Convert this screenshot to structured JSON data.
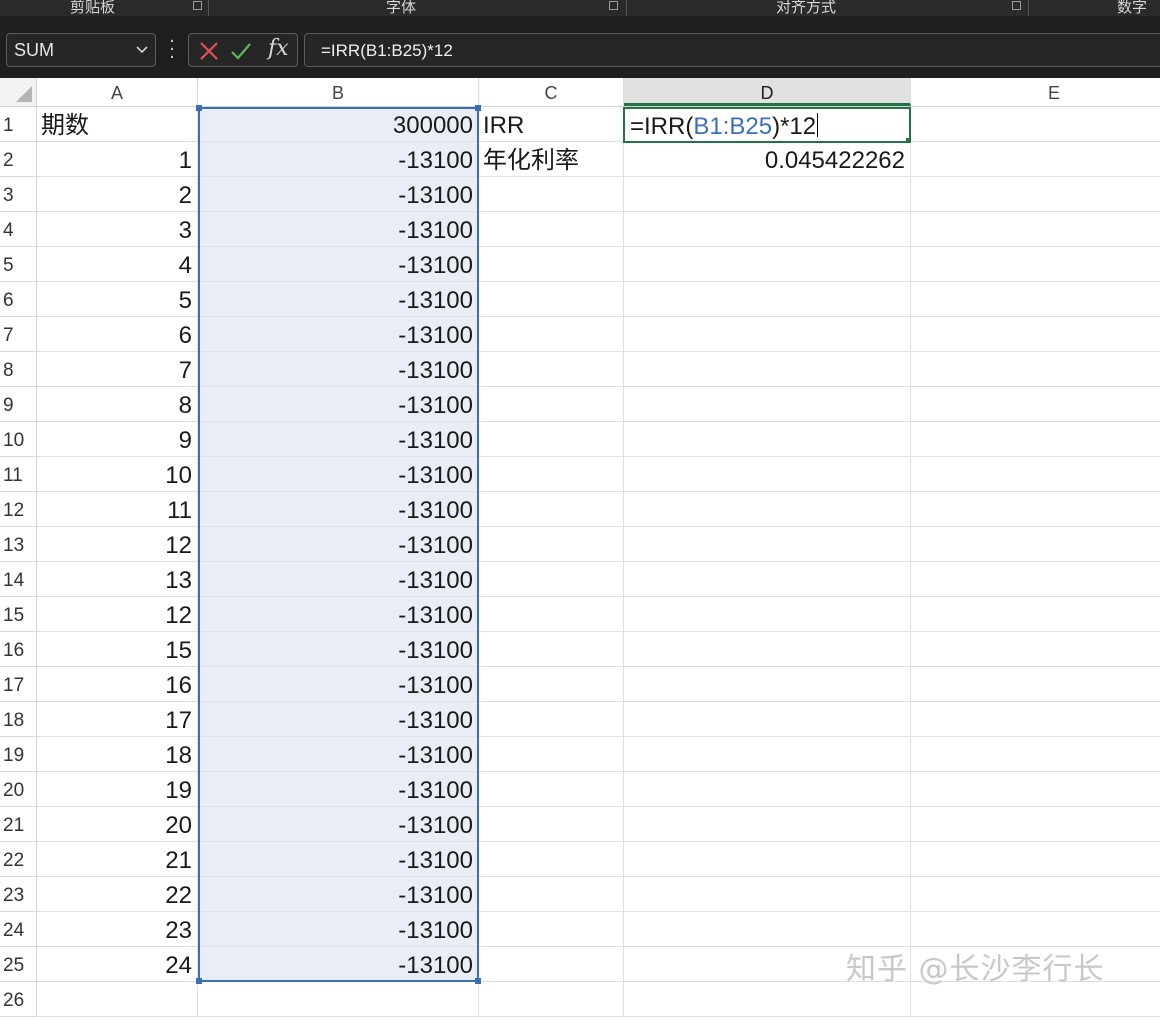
{
  "ribbon": {
    "groups": [
      "剪贴板",
      "字体",
      "对齐方式",
      "数字"
    ]
  },
  "formula_bar": {
    "name_box": "SUM",
    "fx_label": "fx",
    "formula": "=IRR(B1:B25)*12"
  },
  "columns": [
    "A",
    "B",
    "C",
    "D",
    "E"
  ],
  "active_column": "D",
  "rows": [
    {
      "n": "1",
      "a": "期数",
      "b": "300000",
      "c": "IRR"
    },
    {
      "n": "2",
      "a": "1",
      "b": "-13100",
      "c": "年化利率",
      "d": "0.045422262"
    },
    {
      "n": "3",
      "a": "2",
      "b": "-13100"
    },
    {
      "n": "4",
      "a": "3",
      "b": "-13100"
    },
    {
      "n": "5",
      "a": "4",
      "b": "-13100"
    },
    {
      "n": "6",
      "a": "5",
      "b": "-13100"
    },
    {
      "n": "7",
      "a": "6",
      "b": "-13100"
    },
    {
      "n": "8",
      "a": "7",
      "b": "-13100"
    },
    {
      "n": "9",
      "a": "8",
      "b": "-13100"
    },
    {
      "n": "10",
      "a": "9",
      "b": "-13100"
    },
    {
      "n": "11",
      "a": "10",
      "b": "-13100"
    },
    {
      "n": "12",
      "a": "11",
      "b": "-13100"
    },
    {
      "n": "13",
      "a": "12",
      "b": "-13100"
    },
    {
      "n": "14",
      "a": "13",
      "b": "-13100"
    },
    {
      "n": "15",
      "a": "12",
      "b": "-13100"
    },
    {
      "n": "16",
      "a": "15",
      "b": "-13100"
    },
    {
      "n": "17",
      "a": "16",
      "b": "-13100"
    },
    {
      "n": "18",
      "a": "17",
      "b": "-13100"
    },
    {
      "n": "19",
      "a": "18",
      "b": "-13100"
    },
    {
      "n": "20",
      "a": "19",
      "b": "-13100"
    },
    {
      "n": "21",
      "a": "20",
      "b": "-13100"
    },
    {
      "n": "22",
      "a": "21",
      "b": "-13100"
    },
    {
      "n": "23",
      "a": "22",
      "b": "-13100"
    },
    {
      "n": "24",
      "a": "23",
      "b": "-13100"
    },
    {
      "n": "25",
      "a": "24",
      "b": "-13100"
    },
    {
      "n": "26"
    }
  ],
  "edit_cell": {
    "prefix": "=IRR(",
    "ref": "B1:B25",
    "suffix": ")*12"
  },
  "watermark": "知乎 @长沙李行长",
  "colors": {
    "selection_fill": "#e9eef6",
    "selection_border": "#3a6fb5",
    "active_border": "#217346",
    "formula_ref": "#3d6fb8"
  }
}
